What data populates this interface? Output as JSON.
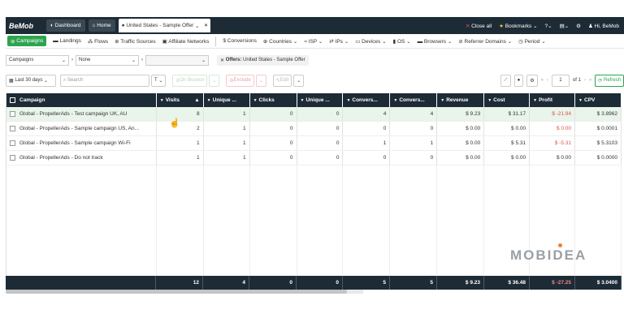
{
  "topbar": {
    "logo": "BeMob",
    "dashboard": "Dashboard",
    "home": "Home",
    "tab": "United States - Sample Offer",
    "tab_close": "×",
    "close_all": "Close all",
    "bookmarks": "Bookmarks",
    "user": "Hi, BeMob"
  },
  "nav": {
    "campaigns": "Campaigns",
    "landings": "Landings",
    "flows": "Flows",
    "traffic": "Traffic Sources",
    "affiliate": "Affiliate Networks",
    "conversions": "Conversions",
    "countries": "Countries",
    "isp": "ISP",
    "ips": "IPs",
    "devices": "Devices",
    "os": "OS",
    "browsers": "Browsers",
    "referrer": "Referrer Domains",
    "period": "Period"
  },
  "filters": {
    "group1": "Campaigns",
    "group2": "None",
    "group3": "",
    "crumb_label": "Offers:",
    "crumb_value": "United States - Sample Offer"
  },
  "toolbar": {
    "range": "Last 30 days",
    "search_placeholder": "Search",
    "filter_btn": "T",
    "on_bounce": "On Bounce",
    "exclude": "Exclude",
    "edit": "Edit",
    "page": "1",
    "of": "of 1",
    "refresh": "Refresh"
  },
  "columns": [
    "Campaign",
    "Visits",
    "Unique ...",
    "Clicks",
    "Unique ...",
    "Convers...",
    "Convers...",
    "Revenue",
    "Cost",
    "Profit",
    "CPV"
  ],
  "rows": [
    {
      "name": "Global - PropellerAds - Test campaign UK, AU",
      "visits": "8",
      "u1": "1",
      "clicks": "0",
      "u2": "0",
      "c1": "4",
      "c2": "4",
      "revenue": "$ 9.23",
      "cost": "$ 31.17",
      "profit": "$ -21.94",
      "cpv": "$ 3.8962"
    },
    {
      "name": "Global - PropellerAds - Sample campaign US, An...",
      "visits": "2",
      "u1": "1",
      "clicks": "0",
      "u2": "0",
      "c1": "0",
      "c2": "0",
      "revenue": "$ 0.00",
      "cost": "$ 0.00",
      "profit": "$ 0.00",
      "cpv": "$ 0.0001"
    },
    {
      "name": "Global - PropellerAds - Sample campaign Wi-Fi",
      "visits": "1",
      "u1": "1",
      "clicks": "0",
      "u2": "0",
      "c1": "1",
      "c2": "1",
      "revenue": "$ 0.00",
      "cost": "$ 5.31",
      "profit": "$ -5.31",
      "cpv": "$ 5.3103"
    },
    {
      "name": "Global - PropellerAds - Do not track",
      "visits": "1",
      "u1": "1",
      "clicks": "0",
      "u2": "0",
      "c1": "0",
      "c2": "0",
      "revenue": "$ 0.00",
      "cost": "$ 0.00",
      "profit": "$ 0.00",
      "cpv": "$ 0.0000"
    }
  ],
  "totals": {
    "visits": "12",
    "u1": "4",
    "clicks": "0",
    "u2": "0",
    "c1": "5",
    "c2": "5",
    "revenue": "$ 9.23",
    "cost": "$ 36.48",
    "profit": "$ -27.25",
    "cpv": "$ 3.0400"
  },
  "watermark": "MOBIDEA"
}
